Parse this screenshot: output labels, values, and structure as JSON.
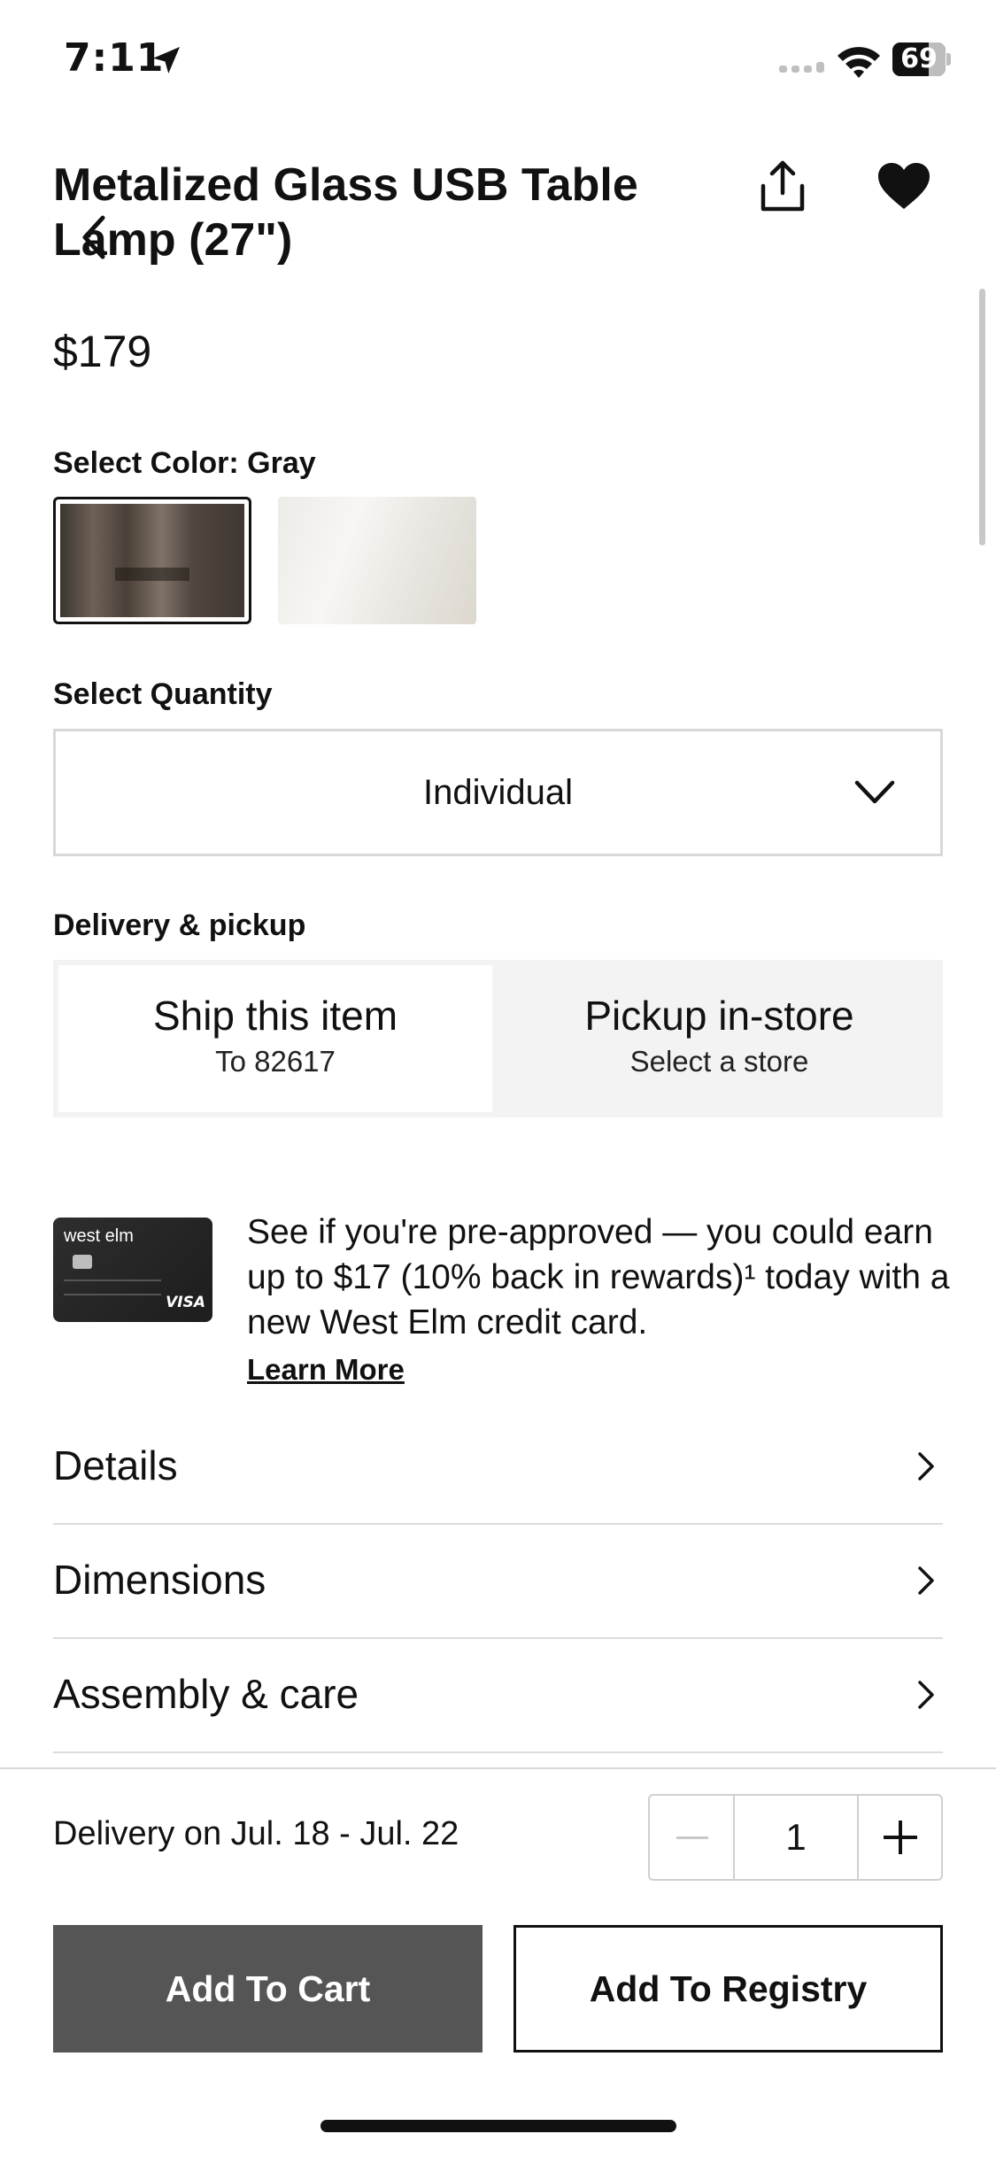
{
  "status_bar": {
    "time": "7:11",
    "battery": "69",
    "battery_level": 0.69
  },
  "product": {
    "title_line1": "Metalized Glass USB Table",
    "title_line2": "Lamp (27\")",
    "price": "$179"
  },
  "color": {
    "label": "Select Color: Gray",
    "options": [
      "Gray",
      "White"
    ],
    "selected": "Gray"
  },
  "quantity": {
    "label": "Select Quantity",
    "value": "Individual"
  },
  "delivery": {
    "label": "Delivery & pickup",
    "ship": {
      "title": "Ship this item",
      "sub": "To 82617"
    },
    "pickup": {
      "title": "Pickup in-store",
      "sub": "Select a store"
    }
  },
  "promo": {
    "card_brand": "west elm",
    "card_network": "VISA",
    "text": "See if you're pre-approved — you could earn up to $17 (10% back in rewards)¹ today with a new West Elm credit card.",
    "link": "Learn More"
  },
  "accordion": [
    "Details",
    "Dimensions",
    "Assembly & care"
  ],
  "bottom": {
    "delivery_estimate": "Delivery on Jul. 18 - Jul. 22",
    "qty": "1",
    "add_to_cart": "Add To Cart",
    "add_to_registry": "Add To Registry"
  },
  "icons": {
    "back": "chevron-left-icon",
    "share": "share-icon",
    "favorite": "heart-icon",
    "location": "location-arrow-icon",
    "wifi": "wifi-icon",
    "cellular": "signal-icon",
    "battery": "battery-icon",
    "dropdown": "chevron-down-icon",
    "row": "chevron-right-icon"
  }
}
